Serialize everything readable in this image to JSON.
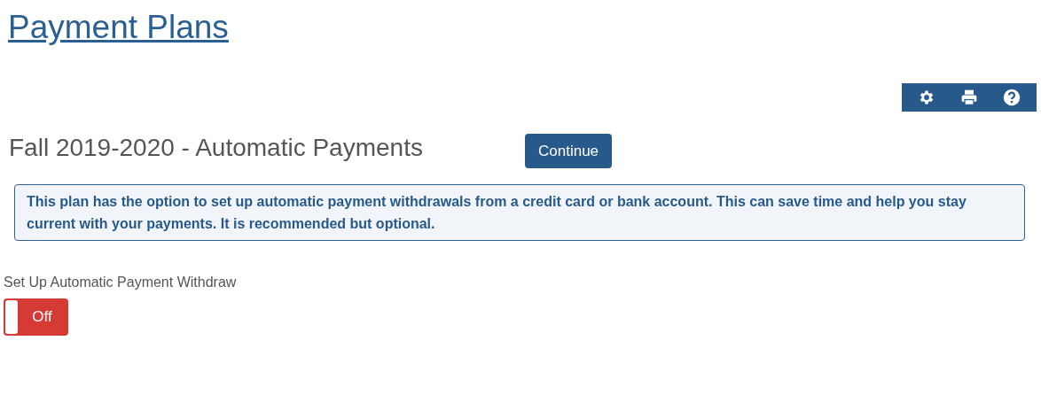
{
  "page_title": "Payment Plans",
  "toolbar": [
    {
      "kind": "settings"
    },
    {
      "kind": "print"
    },
    {
      "kind": "help"
    }
  ],
  "heading": "Fall 2019-2020 - Automatic Payments",
  "continue_button": "Continue",
  "info_message": "This plan has the option to set up automatic payment withdrawals from a credit card or bank account. This can save time and help you stay current with your payments. It is recommended but optional.",
  "toggle": {
    "label": "Set Up Automatic Payment Withdraw",
    "on": false,
    "state_text": "Off"
  }
}
